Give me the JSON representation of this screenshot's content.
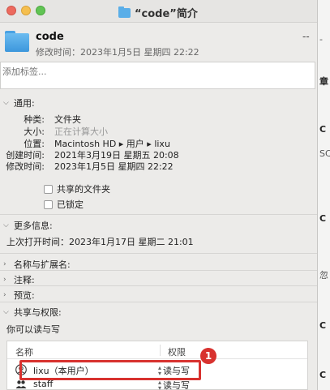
{
  "window": {
    "title": "“code”简介"
  },
  "header": {
    "name": "code",
    "size": "--",
    "modified": "修改时间：2023年1月5日 星期四 22:22"
  },
  "tags": {
    "placeholder": "添加标签..."
  },
  "general": {
    "title": "通用:",
    "rows": [
      {
        "k": "种类:",
        "v": "文件夹"
      },
      {
        "k": "大小:",
        "v": "正在计算大小"
      },
      {
        "k": "位置:",
        "v": "Macintosh HD ▸ 用户 ▸ lixu"
      },
      {
        "k": "创建时间:",
        "v": "2021年3月19日 星期五 20:08"
      },
      {
        "k": "修改时间:",
        "v": "2023年1月5日 星期四 22:22"
      }
    ],
    "shared_folder": "共享的文件夹",
    "locked": "已锁定"
  },
  "more_info": {
    "title": "更多信息:",
    "last_opened": "上次打开时间：2023年1月17日 星期二 21:01"
  },
  "sections": {
    "name_ext": "名称与扩展名:",
    "comments": "注释:",
    "preview": "预览:",
    "sharing": "共享与权限:"
  },
  "permissions": {
    "summary": "你可以读与写",
    "col_name": "名称",
    "col_priv": "权限",
    "rows": [
      {
        "name": "lixu（本用户）",
        "priv": "读与写"
      },
      {
        "name": "staff",
        "priv": "读与写"
      }
    ]
  },
  "annotation": {
    "badge": "1"
  },
  "background_window": [
    "-",
    "章",
    "C",
    "SC",
    "C",
    "忽",
    "C",
    "C"
  ]
}
